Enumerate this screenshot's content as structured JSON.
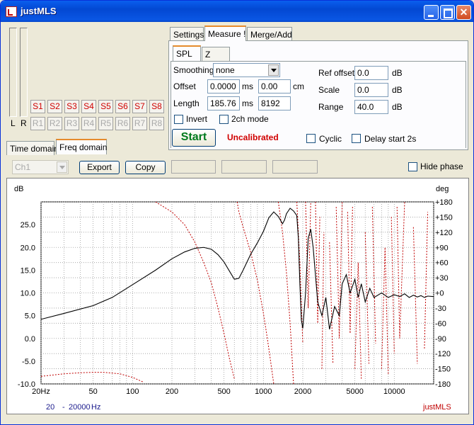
{
  "window": {
    "title": "justMLS"
  },
  "vu": {
    "left_label": "L",
    "right_label": "R"
  },
  "slots_s": [
    "S1",
    "S2",
    "S3",
    "S4",
    "S5",
    "S6",
    "S7",
    "S8"
  ],
  "slots_r": [
    "R1",
    "R2",
    "R3",
    "R4",
    "R5",
    "R6",
    "R7",
    "R8"
  ],
  "tabs_top": [
    "Settings",
    "Measure !",
    "Merge/Add"
  ],
  "tabs_sub": [
    "SPL",
    "Z"
  ],
  "tabs_left": [
    "Time domain",
    "Freq domain"
  ],
  "measure": {
    "smoothing_label": "Smoothing",
    "smoothing_value": "none",
    "offset_label": "Offset",
    "offset_ms": "0.0000",
    "offset_ms_unit": "ms",
    "offset_cm": "0.00",
    "offset_cm_unit": "cm",
    "length_label": "Length",
    "length_ms": "185.76",
    "length_ms_unit": "ms",
    "length_samples": "8192",
    "invert_label": "Invert",
    "ch2_label": "2ch mode",
    "ref_offset_label": "Ref offset",
    "ref_offset_value": "0.0",
    "scale_label": "Scale",
    "scale_value": "0.0",
    "range_label": "Range",
    "range_value": "40.0",
    "db_unit": "dB",
    "start_label": "Start",
    "status": "Uncalibrated",
    "cyclic_label": "Cyclic",
    "delay_label": "Delay start 2s",
    "status_color": "#d00000",
    "start_color": "#007a1e"
  },
  "toolbar": {
    "channel_value": "Ch1",
    "export_label": "Export",
    "copy_label": "Copy",
    "hide_phase_label": "Hide phase"
  },
  "chart_data": {
    "type": "line",
    "ylabel_left": "dB",
    "ylabel_right": "deg",
    "x_scale": "log",
    "xlim": [
      20,
      20000
    ],
    "x_ticks": [
      20,
      50,
      100,
      200,
      500,
      1000,
      2000,
      5000,
      10000
    ],
    "x_tick_labels": [
      "20Hz",
      "50",
      "100",
      "200",
      "500",
      "1000",
      "2000",
      "5000",
      "10000"
    ],
    "ylim": [
      -10,
      30
    ],
    "y_ticks": [
      -10,
      -5,
      0,
      5,
      10,
      15,
      20,
      25
    ],
    "y_tick_labels": [
      "-10.0",
      "-5.0",
      "0.0",
      "5.0",
      "10.0",
      "15.0",
      "20.0",
      "25.0"
    ],
    "phase_lim": [
      -180,
      180
    ],
    "phase_ticks": [
      -180,
      -150,
      -120,
      -90,
      -60,
      -30,
      0,
      30,
      60,
      90,
      120,
      150,
      180
    ],
    "phase_tick_labels": [
      "-180",
      "-150",
      "-120",
      "-90",
      "-60",
      "-30",
      "+0",
      "+30",
      "+60",
      "+90",
      "+120",
      "+150",
      "+180"
    ],
    "grid": true,
    "range_from": "20",
    "range_dash": "-",
    "range_to": "20000",
    "range_unit": "Hz",
    "watermark": "justMLS",
    "series": [
      {
        "color": "#000000",
        "axis": "left",
        "x": [
          20,
          30,
          50,
          70,
          100,
          150,
          200,
          250,
          300,
          350,
          400,
          450,
          500,
          550,
          600,
          650,
          700,
          800,
          900,
          1000,
          1100,
          1200,
          1300,
          1400,
          1450,
          1500,
          1600,
          1700,
          1800,
          1850,
          1900,
          1950,
          2000,
          2100,
          2200,
          2300,
          2400,
          2600,
          2800,
          3000,
          3200,
          3500,
          3800,
          4000,
          4300,
          4600,
          5000,
          5300,
          5600,
          6000,
          6500,
          7000,
          8000,
          9000,
          10000,
          11000,
          12000,
          13000,
          14000,
          15000,
          16000,
          17000,
          18000,
          20000
        ],
        "y": [
          4.2,
          5.5,
          7.2,
          9.0,
          11.8,
          15.0,
          17.5,
          19.0,
          19.8,
          20.0,
          19.6,
          18.4,
          16.8,
          14.8,
          13.0,
          13.2,
          15.0,
          18.5,
          21.0,
          23.5,
          26.5,
          27.8,
          26.8,
          25.2,
          26.0,
          27.4,
          28.6,
          28.0,
          27.0,
          22.0,
          12.0,
          4.0,
          2.2,
          10.0,
          22.0,
          24.0,
          20.0,
          8.0,
          5.0,
          9.0,
          2.0,
          7.0,
          5.0,
          12.0,
          14.0,
          10.0,
          13.0,
          9.0,
          12.0,
          8.0,
          11.0,
          9.0,
          10.0,
          9.0,
          9.6,
          9.2,
          9.8,
          9.0,
          9.5,
          9.1,
          9.4,
          9.0,
          9.3,
          9.2
        ]
      },
      {
        "color": "#c00000",
        "axis": "right",
        "style": "dotted",
        "x": [
          20,
          30,
          40,
          50,
          60,
          80,
          100,
          120,
          150,
          200,
          250,
          300,
          350,
          400,
          450,
          500,
          550,
          600,
          630,
          650,
          700,
          800,
          900,
          1000,
          1050,
          1100,
          1200,
          1300,
          1400,
          1500,
          1600,
          1700,
          1800,
          1900,
          2000,
          2100,
          2200,
          2300,
          2400,
          2500,
          2600,
          2700,
          2800,
          2900,
          3000,
          3200,
          3400,
          3600,
          3800,
          4000,
          4200,
          4400,
          4600,
          4800,
          5000,
          5300,
          5600,
          6000,
          6400,
          6800,
          7200,
          7600,
          8000,
          8500,
          9000,
          9500,
          10000,
          10500,
          11000,
          12000,
          13000,
          14000,
          15000,
          16000,
          17000,
          18000,
          19000,
          20000
        ],
        "y": [
          -165,
          -160,
          -158,
          -157,
          -157,
          -160,
          -167,
          -176,
          180,
          160,
          135,
          100,
          60,
          20,
          -30,
          -80,
          -130,
          -170,
          180,
          160,
          130,
          80,
          25,
          -40,
          -75,
          -110,
          -180,
          180,
          120,
          40,
          -60,
          -180,
          180,
          60,
          -100,
          180,
          -30,
          180,
          -120,
          180,
          -60,
          150,
          -150,
          120,
          -180,
          100,
          -140,
          170,
          -90,
          180,
          -120,
          160,
          -80,
          170,
          -150,
          60,
          -170,
          120,
          -140,
          170,
          -100,
          180,
          -150,
          90,
          -160,
          150,
          -120,
          170,
          -90,
          180,
          -160,
          130,
          -140,
          180,
          -110,
          160,
          -130,
          170
        ]
      }
    ]
  }
}
